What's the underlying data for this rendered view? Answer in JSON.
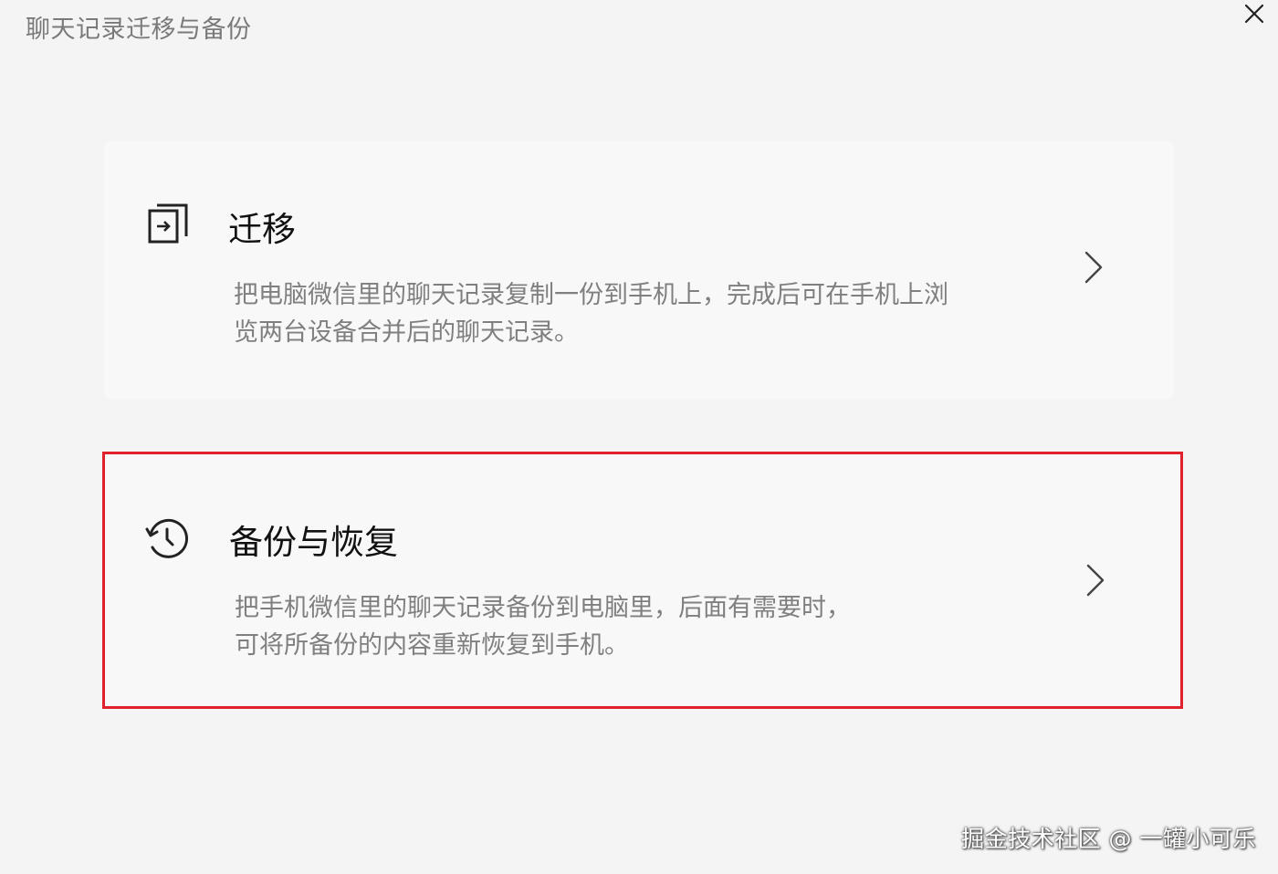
{
  "window": {
    "title": "聊天记录迁移与备份",
    "close_icon": "close-icon"
  },
  "options": [
    {
      "icon": "migrate-icon",
      "heading": "迁移",
      "description_line1": "把电脑微信里的聊天记录复制一份到手机上，完成后可在手机上浏",
      "description_line2": "览两台设备合并后的聊天记录。",
      "chevron_icon": "chevron-right-icon"
    },
    {
      "icon": "history-clock-icon",
      "heading": "备份与恢复",
      "description_line1": "把手机微信里的聊天记录备份到电脑里，后面有需要时，",
      "description_line2": "可将所备份的内容重新恢复到手机。",
      "chevron_icon": "chevron-right-icon",
      "highlight_color": "#e0202a"
    }
  ],
  "watermark": "掘金技术社区 @ 一罐小可乐"
}
